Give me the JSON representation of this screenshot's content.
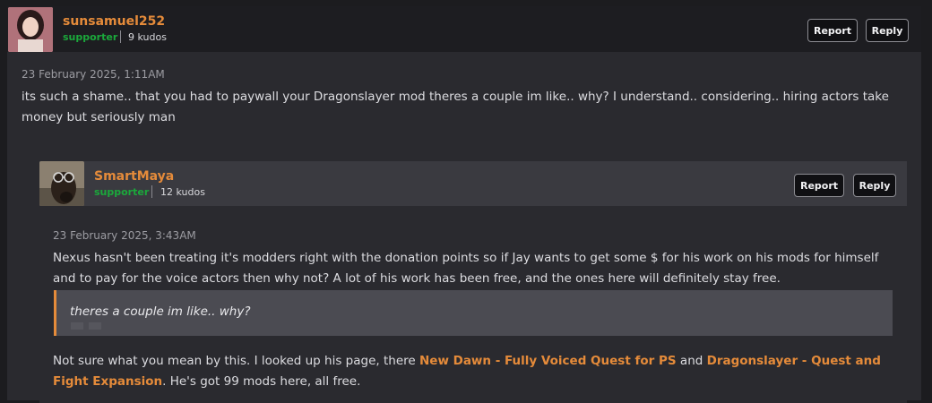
{
  "comment": {
    "author": "sunsamuel252",
    "role": "supporter",
    "kudos": "9 kudos",
    "report_label": "Report",
    "reply_label": "Reply",
    "timestamp": "23 February 2025, 1:11AM",
    "text": "its such a shame.. that you had to paywall your Dragonslayer mod theres a couple im like.. why? I understand.. considering.. hiring actors take money but seriously man"
  },
  "reply": {
    "author": "SmartMaya",
    "role": "supporter",
    "kudos": "12 kudos",
    "report_label": "Report",
    "reply_label": "Reply",
    "timestamp": "23 February 2025, 3:43AM",
    "text": "Nexus hasn't been treating it's modders right with the donation points so if Jay wants to get some $ for his work on his mods for himself and to pay for the voice actors then why not? A lot of his work has been free, and the ones here will definitely stay free.",
    "quote": "theres a couple im like.. why?",
    "text2_prefix": "Not sure what you mean by this.  I looked up his page, there ",
    "link1": "New Dawn - Fully Voiced Quest for PS",
    "text2_mid": " and ",
    "link2": "Dragonslayer - Quest and Fight Expansion",
    "text2_suffix": ". He's got 99 mods here, all free."
  },
  "colors": {
    "accent": "#e58b3a",
    "supporter": "#1ba83b",
    "background": "#2a2a2f",
    "header": "#1d1d21"
  }
}
